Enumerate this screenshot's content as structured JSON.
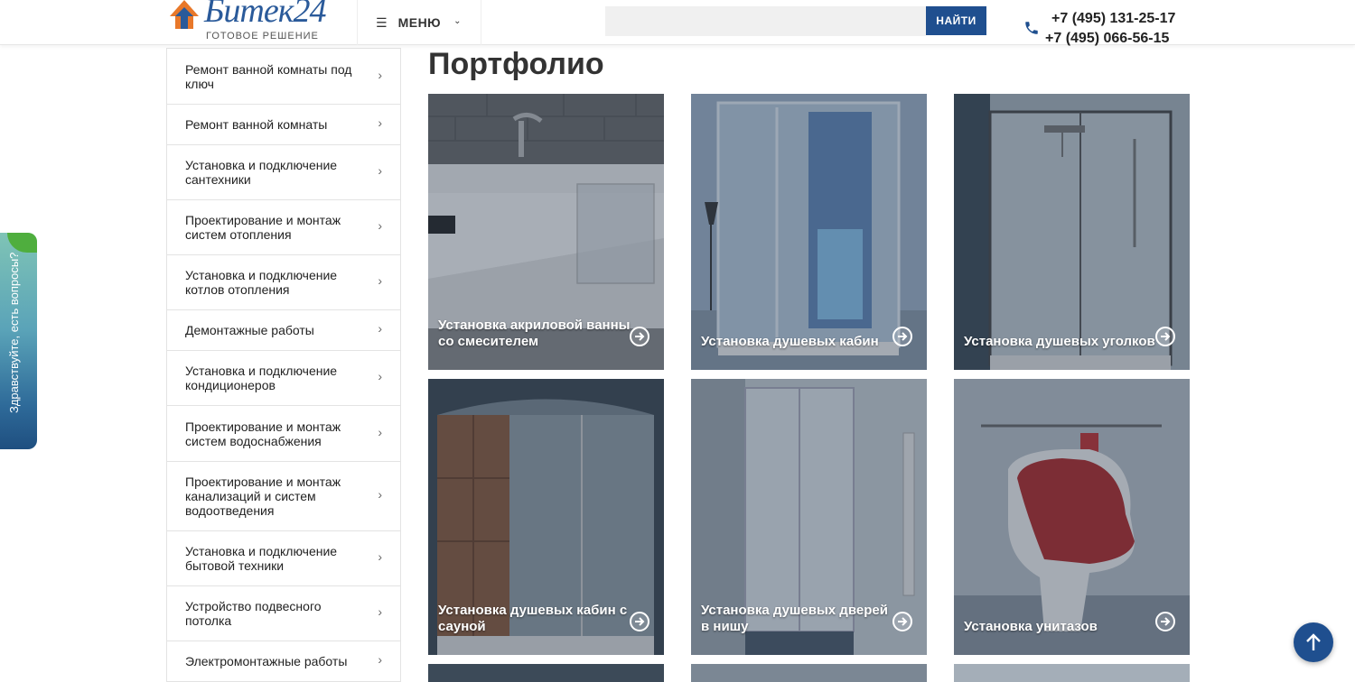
{
  "header": {
    "logo_text": "Битек24",
    "logo_sub": "ГОТОВОЕ РЕШЕНИЕ",
    "menu_label": "МЕНЮ",
    "search_placeholder": "",
    "search_button": "НАЙТИ",
    "phone_1": "+7 (495) 131-25-17",
    "phone_2": "+7 (495) 066-56-15"
  },
  "sidebar": {
    "items": [
      {
        "label": "Ремонт ванной комнаты под ключ"
      },
      {
        "label": "Ремонт ванной комнаты"
      },
      {
        "label": "Установка и подключение сантехники"
      },
      {
        "label": "Проектирование и монтаж систем отопления"
      },
      {
        "label": "Установка и подключение котлов отопления"
      },
      {
        "label": "Демонтажные работы"
      },
      {
        "label": "Установка и подключение кондиционеров"
      },
      {
        "label": "Проектирование и монтаж систем водоснабжения"
      },
      {
        "label": "Проектирование и монтаж канализаций и систем водоотведения"
      },
      {
        "label": "Установка и подключение бытовой техники"
      },
      {
        "label": "Устройство подвесного потолка"
      },
      {
        "label": "Электромонтажные работы"
      }
    ]
  },
  "feedback": {
    "text": "Здравствуйте, есть вопросы?"
  },
  "main": {
    "title": "Портфолио",
    "tiles": [
      {
        "caption": "Установка акриловой ванны со смесителем",
        "theme": "bathtub"
      },
      {
        "caption": "Установка душевых кабин",
        "theme": "cabin"
      },
      {
        "caption": "Установка душевых уголков",
        "theme": "corner"
      },
      {
        "caption": "Установка душевых кабин с сауной",
        "theme": "sauna"
      },
      {
        "caption": "Установка душевых дверей в нишу",
        "theme": "door"
      },
      {
        "caption": "Установка унитазов",
        "theme": "toilet"
      }
    ]
  },
  "colors": {
    "brand": "#1f4f8f",
    "logo_orange": "#e8782a"
  }
}
